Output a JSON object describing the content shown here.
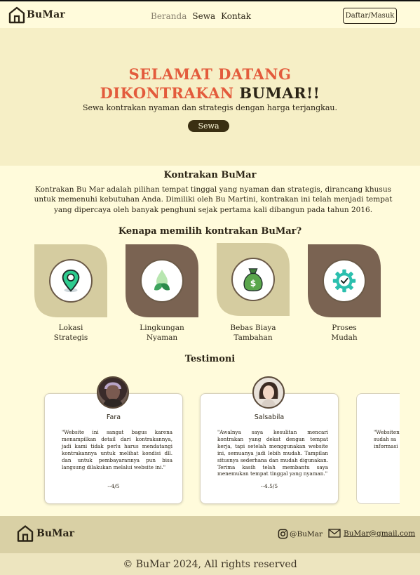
{
  "brand": {
    "name": "BuMar",
    "colors": {
      "accent": "#e35b3c",
      "dark": "#2b2416",
      "brown": "#7a6352",
      "khaki": "#d5cca0",
      "cream": "#fffbdb"
    }
  },
  "nav": {
    "links": [
      {
        "label": "Beranda",
        "active": true
      },
      {
        "label": "Sewa",
        "active": false
      },
      {
        "label": "Kontak",
        "active": false
      }
    ],
    "auth_label": "Daftar/Masuk"
  },
  "hero": {
    "title_line1": "SELAMAT DATANG",
    "title_line2_accent": "DIKONTRAKAN",
    "title_line2_dark": "BUMAR!!",
    "subtitle": "Sewa kontrakan nyaman dan strategis dengan harga terjangkau.",
    "cta_label": "Sewa"
  },
  "about": {
    "title": "Kontrakan BuMar",
    "text": "Kontrakan Bu Mar adalah pilihan tempat tinggal yang nyaman dan strategis, dirancang khusus untuk memenuhi kebutuhan Anda. Dimiliki oleh Bu Martini, kontrakan ini telah menjadi tempat yang dipercaya oleh banyak penghuni sejak pertama kali dibangun pada tahun 2016."
  },
  "why": {
    "title": "Kenapa memilih kontrakan BuMar?",
    "features": [
      {
        "line1": "Lokasi",
        "line2": "Strategis",
        "icon": "map-pin-icon"
      },
      {
        "line1": "Lingkungan",
        "line2": "Nyaman",
        "icon": "leaf-drop-icon"
      },
      {
        "line1": "Bebas Biaya",
        "line2": "Tambahan",
        "icon": "money-bag-icon"
      },
      {
        "line1": "Proses",
        "line2": "Mudah",
        "icon": "gear-check-icon"
      }
    ]
  },
  "testimoni": {
    "title": "Testimoni",
    "items": [
      {
        "name": "Fara",
        "text": "\"Website ini sangat bagus karena menampilkan detail dari kontrakannya, jadi kami tidak perlu harus mendatangi kontrakannya untuk melihat kondisi dll. dan untuk pembayarannya pun bisa langsung dilakukan melalui website ini.\"",
        "rating": "--4/5"
      },
      {
        "name": "Salsabila",
        "text": "\"Awalnya saya kesulitan mencari kontrakan yang dekat dengan tempat kerja, tapi setelah menggunakan website ini, semuanya jadi lebih mudah. Tampilan situsnya sederhana dan mudah digunakan. Terima kasih telah membantu saya menemukan tempat tinggal yang nyaman.\"",
        "rating": "--4.5/5"
      },
      {
        "name": "",
        "text": "\"Websitenya sudah sa informasi",
        "rating": ""
      }
    ]
  },
  "footer": {
    "instagram": "@BuMar",
    "email": "BuMar@gmail.com",
    "copyright": "© BuMar 2024, All rights reserved"
  }
}
